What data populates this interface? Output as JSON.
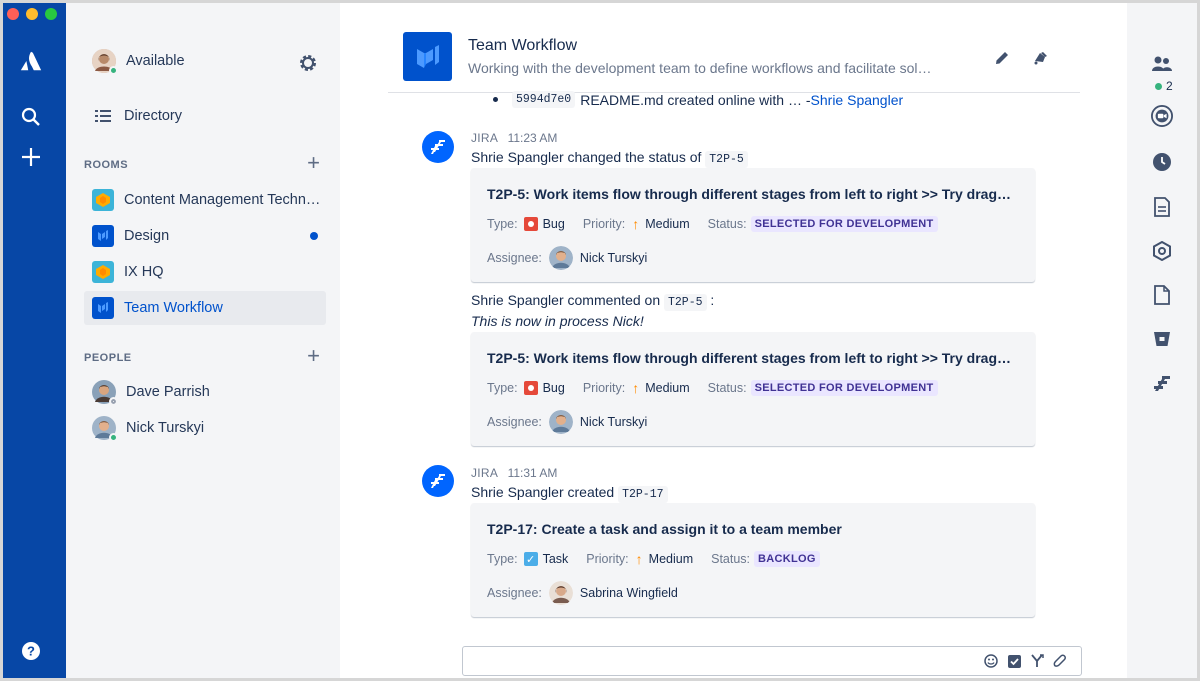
{
  "app": {
    "colors": {
      "nav": "#0747a6",
      "accent": "#0052cc",
      "sidebar": "#f4f5f7",
      "presence_online": "#36b37e"
    }
  },
  "global_nav": {
    "icons": [
      "atlassian-logo-icon",
      "search-icon",
      "create-icon",
      "help-icon"
    ]
  },
  "sidebar": {
    "status_label": "Available",
    "directory_label": "Directory",
    "rooms_title": "ROOMS",
    "rooms": [
      {
        "label": "Content Management Techn…",
        "icon": "room-yellow",
        "unread": false,
        "active": false
      },
      {
        "label": "Design",
        "icon": "room-blue",
        "unread": true,
        "active": false
      },
      {
        "label": "IX HQ",
        "icon": "room-yellow",
        "unread": false,
        "active": false
      },
      {
        "label": "Team Workflow",
        "icon": "room-blue",
        "unread": false,
        "active": true
      }
    ],
    "people_title": "PEOPLE",
    "people": [
      {
        "label": "Dave Parrish",
        "presence": "offline"
      },
      {
        "label": "Nick Turskyi",
        "presence": "online"
      }
    ]
  },
  "header": {
    "room_name": "Team Workflow",
    "topic": "Working with the development team to define workflows and facilitate sol…"
  },
  "messages": {
    "prev": {
      "hash": "5994d7e0",
      "text": "README.md created online with … - ",
      "author": "Shrie Spangler"
    },
    "m1": {
      "sender": "JIRA",
      "time": "11:23 AM",
      "text": "Shrie Spangler changed the status of ",
      "key": "T2P-5",
      "card": {
        "title": "T2P-5: Work items flow through different stages from left to right >> Try drag…",
        "type_key": "Type:",
        "type": "Bug",
        "priority_key": "Priority:",
        "priority": "Medium",
        "status_key": "Status:",
        "status": "SELECTED FOR DEVELOPMENT",
        "assignee_key": "Assignee:",
        "assignee": "Nick Turskyi"
      }
    },
    "m2": {
      "text": "Shrie Spangler commented on ",
      "key": "T2P-5",
      "suffix": " :",
      "comment": "This is now in process Nick!",
      "card": {
        "title": "T2P-5: Work items flow through different stages from left to right >> Try drag…",
        "type_key": "Type:",
        "type": "Bug",
        "priority_key": "Priority:",
        "priority": "Medium",
        "status_key": "Status:",
        "status": "SELECTED FOR DEVELOPMENT",
        "assignee_key": "Assignee:",
        "assignee": "Nick Turskyi"
      }
    },
    "m3": {
      "sender": "JIRA",
      "time": "11:31 AM",
      "text": "Shrie Spangler created ",
      "key": "T2P-17",
      "card": {
        "title": "T2P-17: Create a task and assign it to a team member",
        "type_key": "Type:",
        "type": "Task",
        "priority_key": "Priority:",
        "priority": "Medium",
        "status_key": "Status:",
        "status": "BACKLOG",
        "assignee_key": "Assignee:",
        "assignee": "Sabrina Wingfield"
      }
    }
  },
  "composer": {
    "placeholder": ""
  },
  "right_rail": {
    "participants_count": "2",
    "icons": [
      "people-icon",
      "video-icon",
      "clock-icon",
      "document-icon",
      "hexagon-icon",
      "file-icon",
      "bitbucket-icon",
      "jira-icon"
    ]
  }
}
